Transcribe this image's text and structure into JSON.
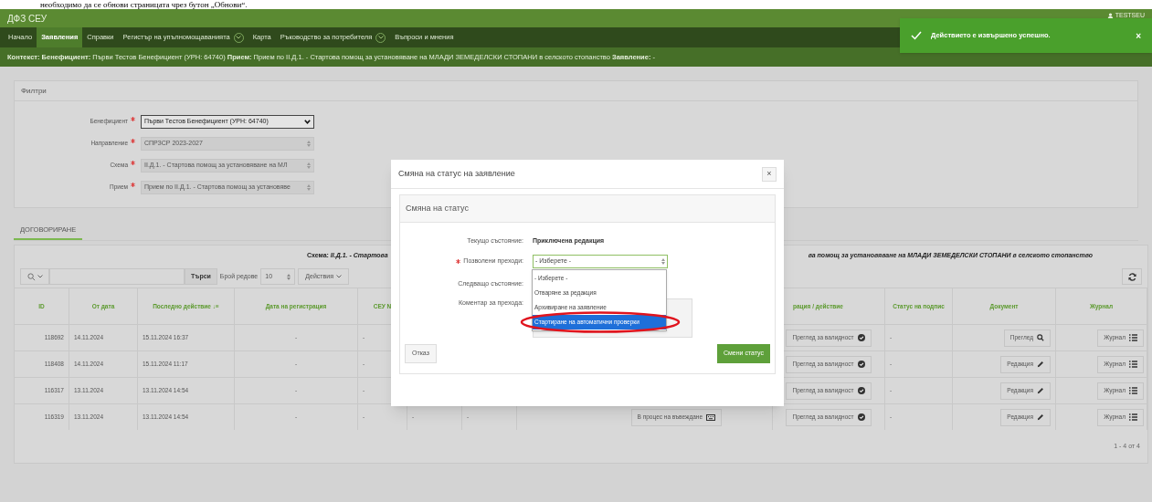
{
  "document_text": "необходимо да се обнови страницата чрез бутон „Обнови“.",
  "app": {
    "title": "ДФЗ СЕУ",
    "user": "TESTSEU"
  },
  "nav": [
    {
      "label": "Начало",
      "selected": false,
      "has_menu": false
    },
    {
      "label": "Заявления",
      "selected": true,
      "has_menu": false
    },
    {
      "label": "Справки",
      "selected": false,
      "has_menu": false
    },
    {
      "label": "Регистър на упълномощаванията",
      "selected": false,
      "has_menu": true
    },
    {
      "label": "Карта",
      "selected": false,
      "has_menu": false
    },
    {
      "label": "Ръководство за потребителя",
      "selected": false,
      "has_menu": true
    },
    {
      "label": "Въпроси и мнения",
      "selected": false,
      "has_menu": false
    }
  ],
  "context": "**Контекст: Бенефициент:** Първи Тестов Бенефициент (УРН: 64740) **Прием:** Прием по II.Д.1. - Стартова помощ за установяване на МЛАДИ ЗЕМЕДЕЛСКИ СТОПАНИ в селското стопанство **Заявление:** -",
  "toast": {
    "message": "Действието е извършено успешно.",
    "close": "×"
  },
  "filters": {
    "title": "Филтри",
    "fields": [
      {
        "label": "Бенефициент",
        "value": "Първи Тестов Бенефициент (УРН: 64740)",
        "required": true,
        "disabled": false
      },
      {
        "label": "Направление",
        "value": "СПРЗСР 2023-2027",
        "required": true,
        "disabled": true
      },
      {
        "label": "Схема",
        "value": "II.Д.1. - Стартова помощ за установяване на МЛ",
        "required": true,
        "disabled": true
      },
      {
        "label": "Прием",
        "value": "Прием по II.Д.1. - Стартова помощ за установяве",
        "required": true,
        "disabled": true
      }
    ]
  },
  "tabs": [
    {
      "label": "ДОГОВОРИРАНЕ",
      "selected": true
    }
  ],
  "scheme_left": "Схема: *II.Д.1. - Стартова*",
  "scheme_right": "ва помощ за установяване на МЛАДИ ЗЕМЕДЕЛСКИ СТОПАНИ в селското стопанство",
  "toolbar": {
    "search_button": "Търси",
    "rows_label": "Брой редове",
    "rows_value": "10",
    "actions": "Действия"
  },
  "table": {
    "headers": {
      "id": "ID",
      "from_date": "От дата",
      "last_action": "Последно действие ↓≡",
      "registration_date": "Дата на регистрация",
      "seu": "СЕУ N",
      "validity": "рация / действие",
      "signature_status": "Статус на подпис",
      "document": "Документ",
      "journal": "Журнал"
    },
    "rows": [
      {
        "id": "118692",
        "from_date": "14.11.2024",
        "last_action": "15.11.2024 16:37",
        "registration_date": "-",
        "seu": "-",
        "validity": "Преглед за валидност",
        "signature_status": "-",
        "document": {
          "label": "Преглед",
          "kind": "view"
        },
        "journal": "Журнал"
      },
      {
        "id": "118408",
        "from_date": "14.11.2024",
        "last_action": "15.11.2024 11:17",
        "registration_date": "-",
        "seu": "-",
        "validity": "Преглед за валидност",
        "signature_status": "-",
        "document": {
          "label": "Редакция",
          "kind": "edit"
        },
        "journal": "Журнал"
      },
      {
        "id": "116317",
        "from_date": "13.11.2024",
        "last_action": "13.11.2024 14:54",
        "registration_date": "-",
        "seu": "-",
        "validity": "Преглед за валидност",
        "signature_status": "-",
        "document": {
          "label": "Редакция",
          "kind": "edit"
        },
        "journal": "Журнал"
      },
      {
        "id": "116319",
        "from_date": "13.11.2024",
        "last_action": "13.11.2024 14:54",
        "registration_date": "-",
        "seu": "-",
        "column_6": "-",
        "column_7": "-",
        "column_8": "В процес на въвеждане",
        "validity": "Преглед за валидност",
        "signature_status": "-",
        "document": {
          "label": "Редакция",
          "kind": "edit"
        },
        "journal": "Журнал"
      }
    ],
    "pagination": "1 - 4 от 4"
  },
  "modal": {
    "title": "Смяна на статус на заявление",
    "close": "×",
    "panel_title": "Смяна на статус",
    "current_label": "Текущо състояние:",
    "current_value": "Приключена редакция",
    "transitions_label": "Позволени преходи:",
    "transitions_value": "- Изберете -",
    "transitions_required": true,
    "next_label": "Следващо състояние:",
    "comment_label": "Коментар за прехода:",
    "options": [
      {
        "label": "- Изберете -",
        "selected": false,
        "circled": false
      },
      {
        "label": "Отваряне за редакция",
        "selected": false,
        "circled": false
      },
      {
        "label": "Архивиране на заявление",
        "selected": false,
        "circled": false
      },
      {
        "label": "Стартиране на автоматични проверки",
        "selected": true,
        "circled": true
      }
    ],
    "cancel": "Отказ",
    "submit": "Смени статус"
  }
}
